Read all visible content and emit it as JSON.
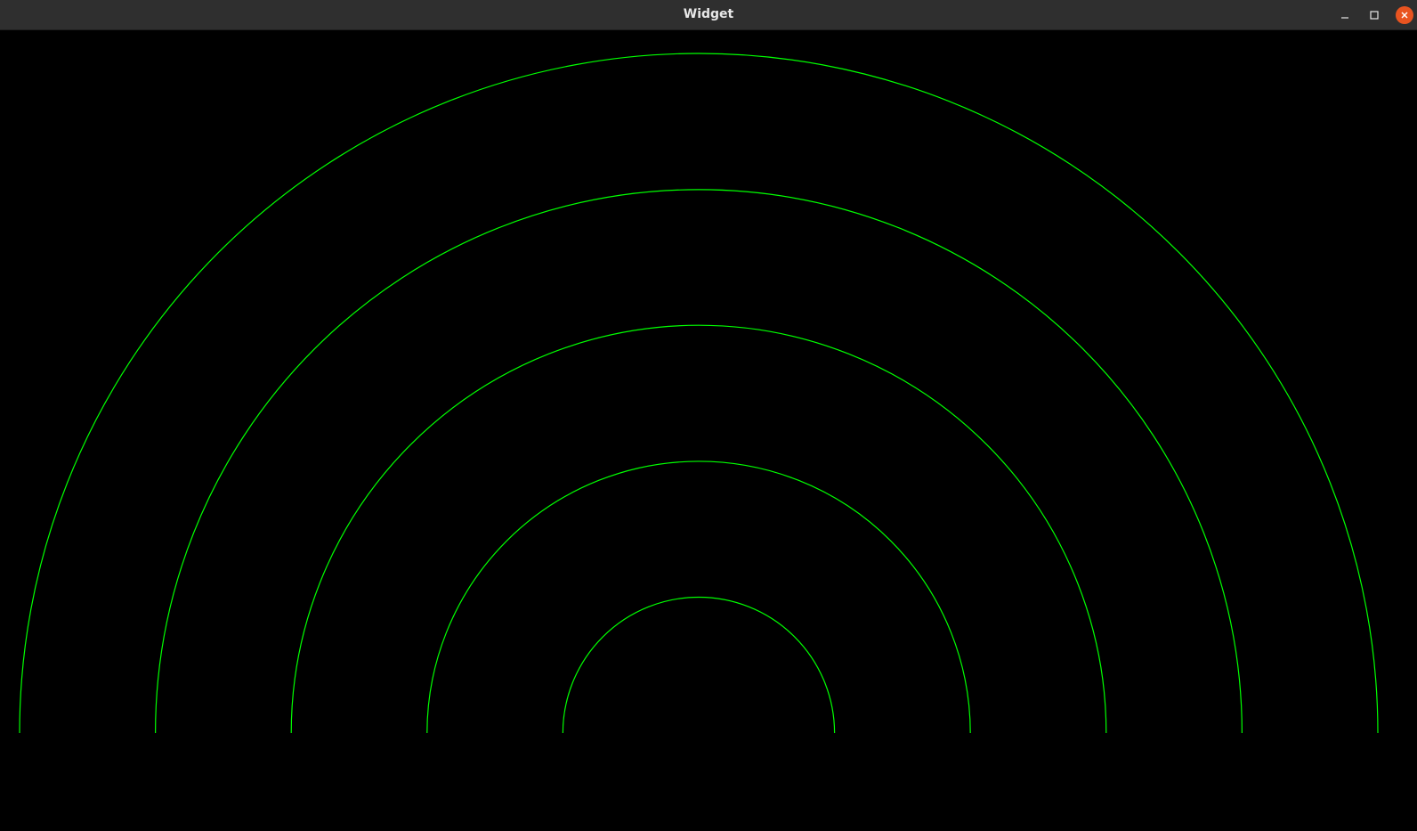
{
  "window": {
    "title": "Widget",
    "controls": {
      "minimize_icon": "minimize-icon",
      "maximize_icon": "maximize-icon",
      "close_icon": "close-icon"
    },
    "colors": {
      "titlebar": "#2f2f2f",
      "title_text": "#e8e8e8",
      "close_button": "#e95420"
    }
  },
  "canvas": {
    "background": "#000000",
    "stroke_color": "#00ff00",
    "semicircles": [
      {
        "radius_rank": 1
      },
      {
        "radius_rank": 2
      },
      {
        "radius_rank": 3
      },
      {
        "radius_rank": 4
      },
      {
        "radius_rank": 5
      }
    ]
  }
}
